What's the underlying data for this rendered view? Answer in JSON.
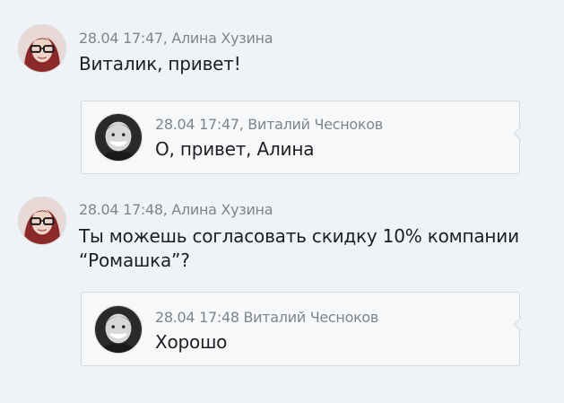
{
  "messages": [
    {
      "timestamp": "28.04 17:47,",
      "author": "Алина Хузина",
      "text_lines": [
        "Виталик, привет!"
      ],
      "avatar": "alina-avatar"
    },
    {
      "timestamp": "28.04 17:47,",
      "author": "Виталий Чесноков",
      "text_lines": [
        "О, привет, Алина"
      ],
      "avatar": "vitaly-avatar"
    },
    {
      "timestamp": "28.04 17:48,",
      "author": "Алина Хузина",
      "text_lines": [
        "Ты можешь согласовать скидку 10% компании",
        "“Ромашка”?"
      ],
      "avatar": "alina-avatar"
    },
    {
      "timestamp": "28.04 17:48",
      "author": "Виталий Чесноков",
      "text_lines": [
        "Хорошо"
      ],
      "avatar": "vitaly-avatar"
    }
  ],
  "colors": {
    "background": "#f0f3f6",
    "reply_background": "#f6f8fa",
    "border": "#d4d9de",
    "meta_text": "#7d858d",
    "body_text": "#1c1e21"
  }
}
